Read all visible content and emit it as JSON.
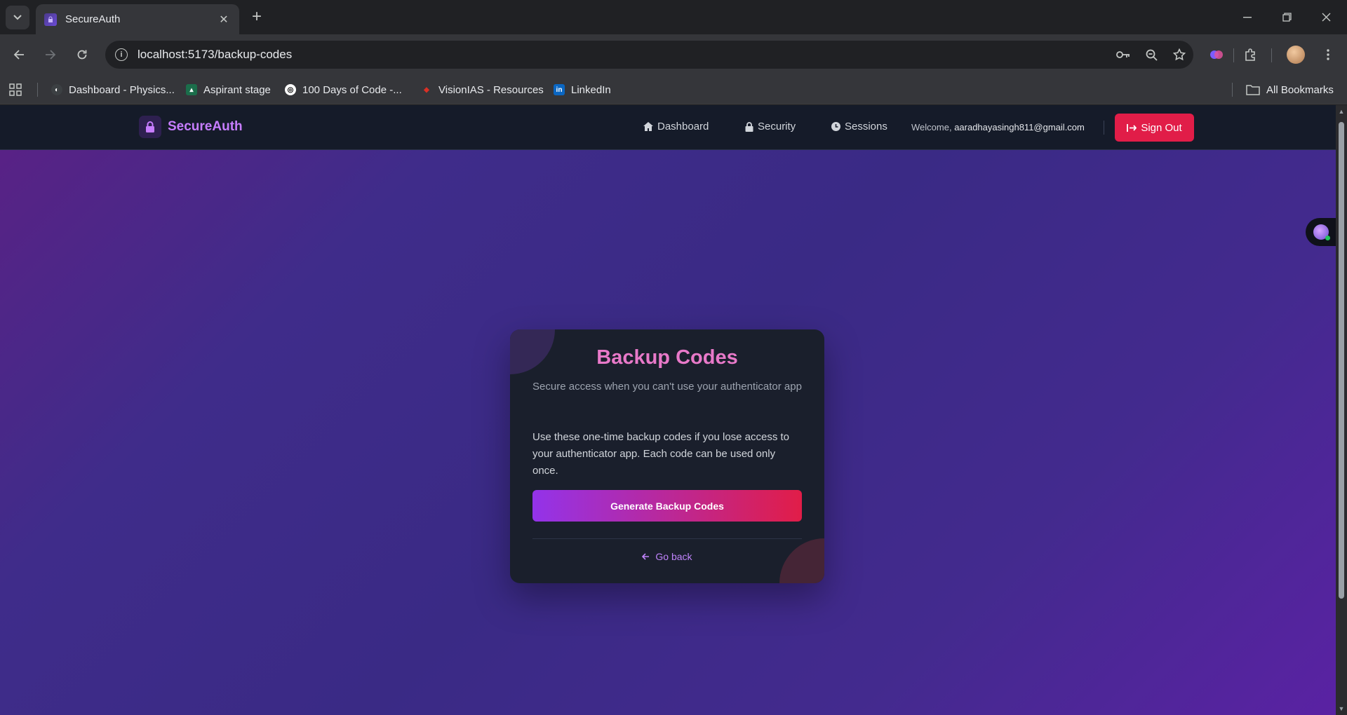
{
  "browser": {
    "tab": {
      "title": "SecureAuth"
    },
    "url": "localhost:5173/backup-codes",
    "bookmarks": [
      {
        "label": "Dashboard - Physics...",
        "icon": "physics-icon",
        "color": "#3c4043"
      },
      {
        "label": "Aspirant stage",
        "icon": "aspirant-icon",
        "color": "#1b6e4b"
      },
      {
        "label": "100 Days of Code -...",
        "icon": "code-icon",
        "color": "#ffffff"
      },
      {
        "label": "VisionIAS - Resources",
        "icon": "visionias-icon",
        "color": "#d93025"
      },
      {
        "label": "LinkedIn",
        "icon": "linkedin-icon",
        "color": "#0a66c2"
      }
    ],
    "all_bookmarks": "All Bookmarks"
  },
  "app": {
    "brand": "SecureAuth",
    "nav": {
      "dashboard": "Dashboard",
      "security": "Security",
      "sessions": "Sessions"
    },
    "welcome_prefix": "Welcome,",
    "welcome_email": "aaradhayasingh811@gmail.com",
    "sign_out": "Sign Out"
  },
  "card": {
    "title": "Backup Codes",
    "subtitle": "Secure access when you can't use your authenticator app",
    "body": "Use these one-time backup codes if you lose access to your authenticator app. Each code can be used only once.",
    "generate_button": "Generate Backup Codes",
    "go_back": "Go back"
  },
  "colors": {
    "accent_purple": "#9333ea",
    "accent_red": "#e11d48",
    "title_pink": "#e879c9",
    "brand_purple": "#c77dff"
  }
}
